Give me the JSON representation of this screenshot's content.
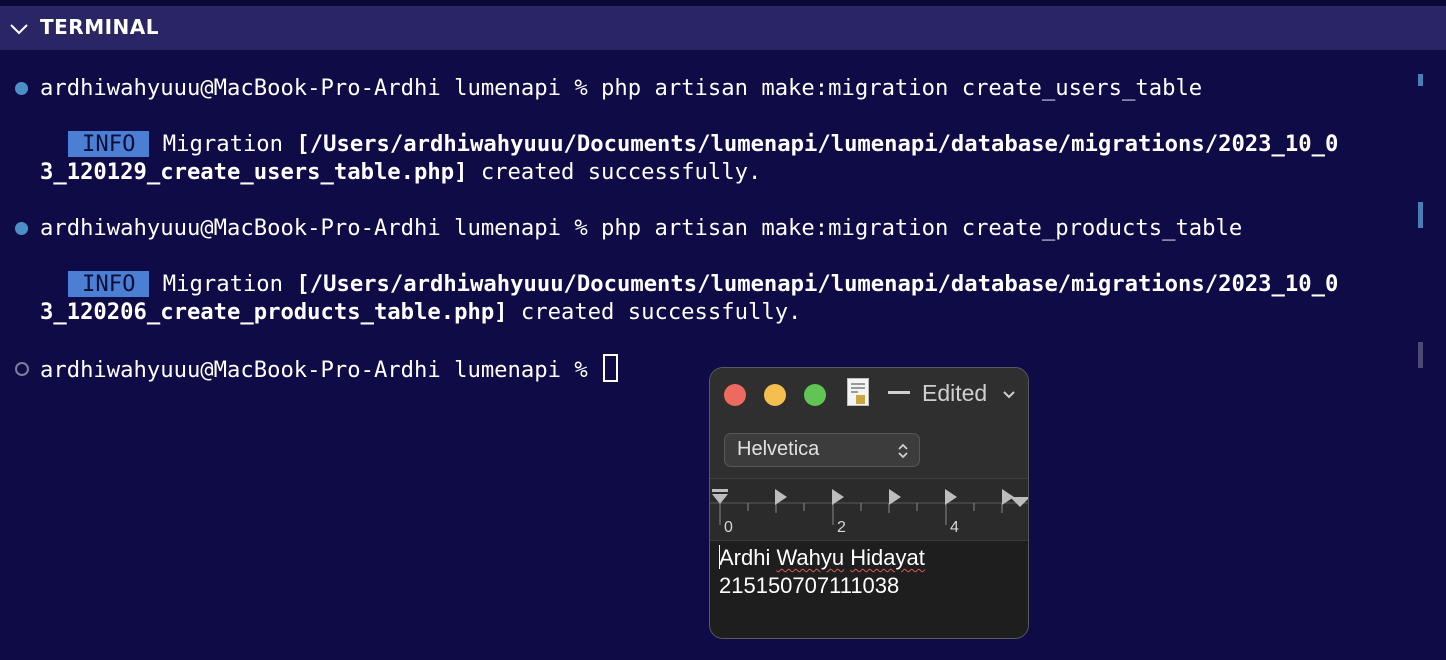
{
  "panel": {
    "title": "TERMINAL"
  },
  "terminal": {
    "prompt": "ardhiwahyuuu@MacBook-Pro-Ardhi lumenapi % ",
    "commands": [
      {
        "command": "php artisan make:migration create_users_table",
        "badge": "INFO",
        "message_prefix": " Migration ",
        "path_line1": "[/Users/ardhiwahyuuu/Documents/lumenapi/lumenapi/database/migrations/2023_10_0",
        "path_line2": "3_120129_create_users_table.php]",
        "message_suffix": " created successfully."
      },
      {
        "command": "php artisan make:migration create_products_table",
        "badge": "INFO",
        "message_prefix": " Migration ",
        "path_line1": "[/Users/ardhiwahyuuu/Documents/lumenapi/lumenapi/database/migrations/2023_10_0",
        "path_line2": "3_120206_create_products_table.php]",
        "message_suffix": " created successfully."
      }
    ],
    "colors": {
      "background": "#0f0b47",
      "header": "#2a2666",
      "badge": "#4a7fd4",
      "completed_dot": "#4b8fc7"
    }
  },
  "textedit": {
    "title_suffix": "Edited",
    "font_name": "Helvetica",
    "ruler_labels": [
      "0",
      "2",
      "4"
    ],
    "text_line1_word1": "Ardhi",
    "text_line1_word2": "Wahyu",
    "text_line1_word3": "Hidayat",
    "text_line2": "215150707111038",
    "icons": {
      "close": "close-button",
      "minimize": "minimize-button",
      "zoom": "zoom-button",
      "document": "document-icon"
    }
  }
}
